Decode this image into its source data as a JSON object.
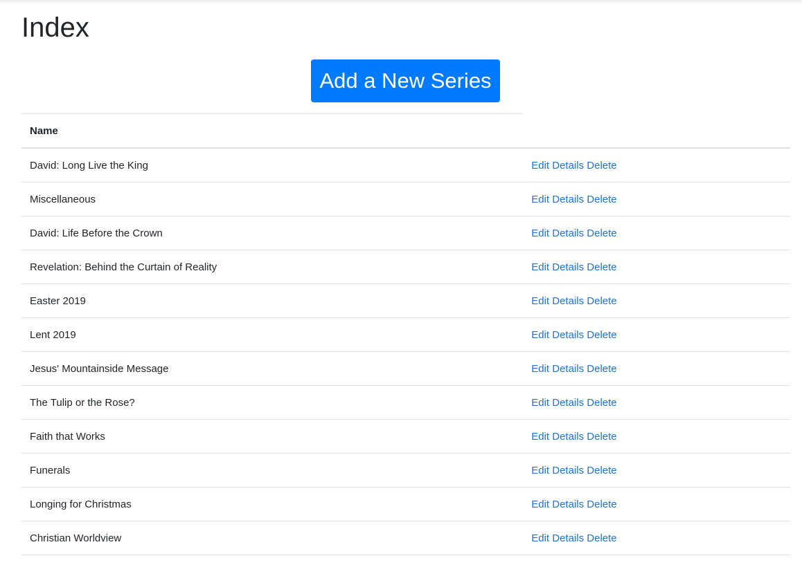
{
  "page": {
    "title": "Index",
    "add_button_label": "Add a New Series"
  },
  "table": {
    "columns": [
      "Name",
      ""
    ],
    "action_labels": {
      "edit": "Edit",
      "details": "Details",
      "delete": "Delete"
    },
    "rows": [
      {
        "name": "David: Long Live the King"
      },
      {
        "name": "Miscellaneous"
      },
      {
        "name": "David: Life Before the Crown"
      },
      {
        "name": "Revelation: Behind the Curtain of Reality"
      },
      {
        "name": "Easter 2019"
      },
      {
        "name": "Lent 2019"
      },
      {
        "name": "Jesus' Mountainside Message"
      },
      {
        "name": "The Tulip or the Rose?"
      },
      {
        "name": "Faith that Works"
      },
      {
        "name": "Funerals"
      },
      {
        "name": "Longing for Christmas"
      },
      {
        "name": "Christian Worldview"
      }
    ]
  },
  "colors": {
    "primary": "#007bff",
    "link": "#1a73d9",
    "border": "#dee2e6",
    "text": "#212529"
  }
}
